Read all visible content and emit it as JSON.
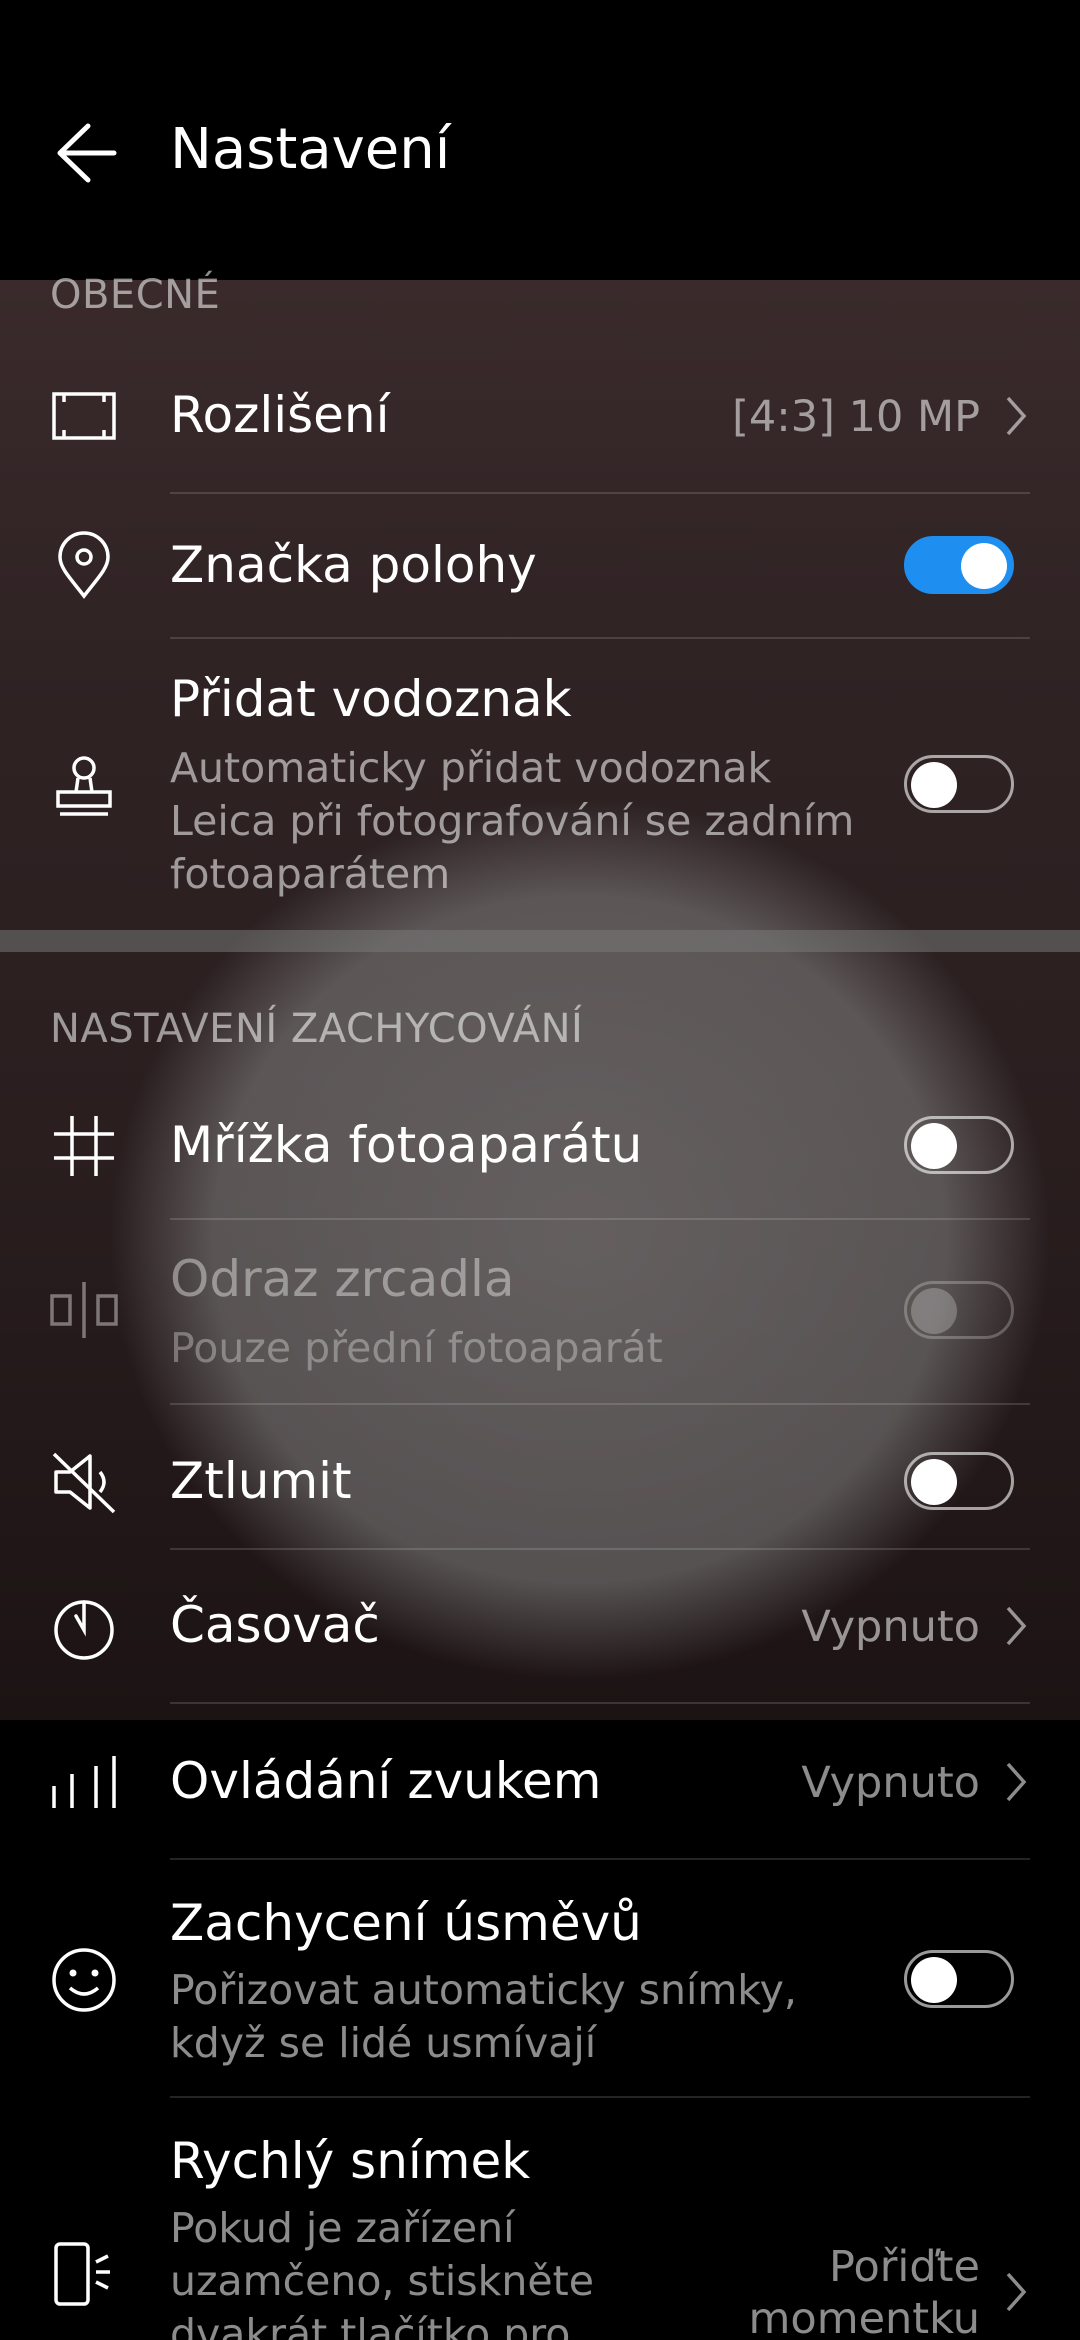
{
  "header": {
    "title": "Nastavení",
    "back_icon": "arrow-left-icon"
  },
  "sections": {
    "general": "OBECNÉ",
    "capture": "NASTAVENÍ ZACHYCOVÁNÍ"
  },
  "items": {
    "resolution": {
      "label": "Rozlišení",
      "value": "[4:3] 10 MP",
      "icon": "resolution-frame-icon"
    },
    "location": {
      "label": "Značka polohy",
      "toggle": true,
      "icon": "location-pin-icon"
    },
    "watermark": {
      "label": "Přidat vodoznak",
      "sub1": "Automaticky přidat vodoznak",
      "sub2": "Leica při fotografování se zadním",
      "sub3": "fotoaparátem",
      "toggle": false,
      "icon": "stamp-icon"
    },
    "grid": {
      "label": "Mřížka fotoaparátu",
      "toggle": false,
      "icon": "grid-icon"
    },
    "mirror": {
      "label": "Odraz zrcadla",
      "sub": "Pouze přední fotoaparát",
      "toggle": false,
      "enabled": false,
      "icon": "mirror-icon"
    },
    "mute": {
      "label": "Ztlumit",
      "toggle": false,
      "icon": "speaker-mute-icon"
    },
    "timer": {
      "label": "Časovač",
      "value": "Vypnuto",
      "icon": "timer-icon"
    },
    "audio_control": {
      "label": "Ovládání zvukem",
      "value": "Vypnuto",
      "icon": "sound-wave-icon"
    },
    "smile": {
      "label": "Zachycení úsměvů",
      "sub1": "Pořizovat automaticky snímky,",
      "sub2": "když se lidé usmívají",
      "toggle": false,
      "icon": "smile-icon"
    },
    "quick_snap": {
      "label": "Rychlý snímek",
      "sub1": "Pokud je zařízení",
      "sub2": "uzamčeno, stiskněte",
      "sub3": "dvakrát tlačítko pro",
      "value1": "Pořiďte",
      "value2": "momentku",
      "icon": "phone-volume-icon"
    }
  },
  "colors": {
    "accent": "#1e8ef0",
    "background": "#000000"
  }
}
